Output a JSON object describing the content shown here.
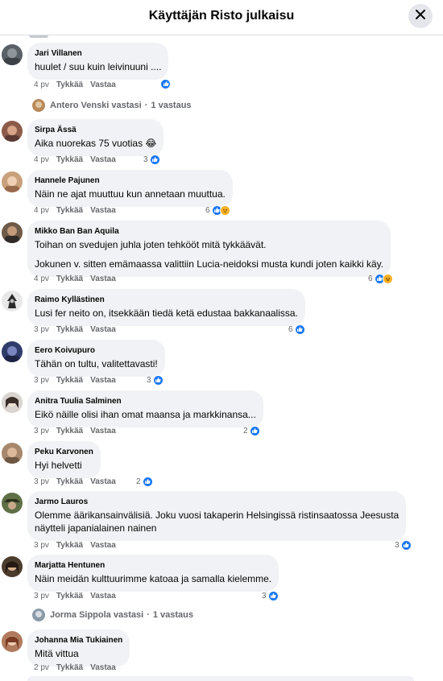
{
  "header": {
    "title": "Käyttäjän Risto julkaisu"
  },
  "actions": {
    "like": "Tykkää",
    "reply": "Vastaa"
  },
  "comments": [
    {
      "author": "Jari Villanen",
      "text": "huulet / suu kuin leivinuuni ....",
      "age": "4 pv",
      "reactions": {
        "count": "",
        "types": [
          "like"
        ]
      }
    },
    {
      "author": "Sirpa Ässä",
      "text": "Aika nuorekas 75 vuotias 😂",
      "age": "4 pv",
      "reactions": {
        "count": "3",
        "types": [
          "like"
        ]
      }
    },
    {
      "author": "Hannele Pajunen",
      "text": "Näin ne ajat muuttuu kun annetaan muuttua.",
      "age": "4 pv",
      "reactions": {
        "count": "6",
        "types": [
          "like",
          "sad"
        ]
      }
    },
    {
      "author": "Mikko Ban Ban Aquila",
      "text": "Toihan on svedujen juhla joten tehkööt mitä tykkäävät.",
      "text2": "Jokunen v. sitten emämaassa valittiin Lucia-neidoksi musta kundi joten kaikki käy.",
      "age": "4 pv",
      "reactions": {
        "count": "6",
        "types": [
          "like",
          "haha"
        ]
      }
    },
    {
      "author": "Raimo Kyllästinen",
      "text": "Lusi fer neito on, itsekkään tiedä ketä edustaa bakkanaalissa.",
      "age": "3 pv",
      "reactions": {
        "count": "6",
        "types": [
          "like"
        ]
      }
    },
    {
      "author": "Eero Koivupuro",
      "text": "Tähän on tultu, valitettavasti!",
      "age": "3 pv",
      "reactions": {
        "count": "3",
        "types": [
          "like"
        ]
      }
    },
    {
      "author": "Anitra Tuulia Salminen",
      "text": "Eikö näille olisi ihan omat maansa ja markkinansa...",
      "age": "3 pv",
      "reactions": {
        "count": "2",
        "types": [
          "like"
        ]
      }
    },
    {
      "author": "Peku Karvonen",
      "text": "Hyi helvetti",
      "age": "3 pv",
      "reactions": {
        "count": "2",
        "types": [
          "like"
        ]
      }
    },
    {
      "author": "Jarmo Lauros",
      "text": "Olemme äärikansainvälisiä. Joku vuosi takaperin Helsingissä ristinsaatossa Jeesusta",
      "text_line2": "näytteli japanialainen nainen",
      "age": "3 pv",
      "reactions": {
        "count": "3",
        "types": [
          "like"
        ]
      }
    },
    {
      "author": "Marjatta Hentunen",
      "text": "Näin meidän kulttuurimme katoaa ja samalla kielemme.",
      "age": "3 pv",
      "reactions": {
        "count": "3",
        "types": [
          "like"
        ]
      }
    },
    {
      "author": "Johanna Mia Tukiainen",
      "text": "Mitä vittua",
      "age": "2 pv",
      "reactions": {
        "count": "",
        "types": []
      }
    }
  ],
  "replies": [
    {
      "name": "Antero Venski vastasi",
      "count": "1 vastaus"
    },
    {
      "name": "Jorma Sippola vastasi",
      "count": "1 vastaus"
    }
  ],
  "colors": {
    "like": "#1877f2",
    "bubble": "#f0f2f5",
    "secondary_text": "#65676b"
  }
}
